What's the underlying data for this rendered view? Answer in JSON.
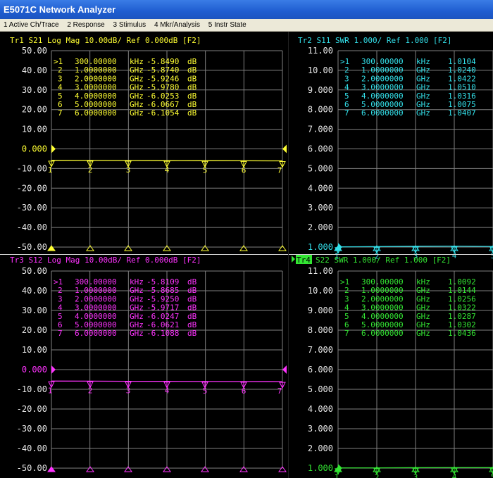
{
  "window": {
    "title": "E5071C Network Analyzer"
  },
  "menu": [
    {
      "id": "active-ch-trace",
      "label": "1 Active Ch/Trace"
    },
    {
      "id": "response",
      "label": "2 Response"
    },
    {
      "id": "stimulus",
      "label": "3 Stimulus"
    },
    {
      "id": "mkr-analysis",
      "label": "4 Mkr/Analysis"
    },
    {
      "id": "instr-state",
      "label": "5 Instr State"
    }
  ],
  "colors": {
    "background": "#000000",
    "grid": "#808080",
    "tr1": "#ffff33",
    "tr2": "#33e0ea",
    "tr3": "#ff33ff",
    "tr4": "#33e633",
    "menubar": "#ece9d8",
    "titlebar": "#2060d8"
  },
  "traces": [
    {
      "id": "tr1",
      "header": "Tr1  S21  Log Mag 10.00dB/  Ref 0.000dB  [F2]",
      "ticks": [
        "50.00",
        "40.00",
        "30.00",
        "20.00",
        "10.00",
        "0.000",
        "-10.00",
        "-20.00",
        "-30.00",
        "-40.00",
        "-50.00"
      ],
      "ylim": [
        -50,
        50
      ],
      "ref_value": 0,
      "ref_label": "0.000",
      "active": false,
      "icon_left": "ref-level-arrow-icon",
      "markers": [
        {
          "num": "1",
          "sel": ">1",
          "freq": "300.00000",
          "unit": "kHz",
          "val": "-5.8490",
          "vunit": "dB"
        },
        {
          "num": "2",
          "sel": "2",
          "freq": "1.0000000",
          "unit": "GHz",
          "val": "-5.8740",
          "vunit": "dB"
        },
        {
          "num": "3",
          "sel": "3",
          "freq": "2.0000000",
          "unit": "GHz",
          "val": "-5.9246",
          "vunit": "dB"
        },
        {
          "num": "4",
          "sel": "4",
          "freq": "3.0000000",
          "unit": "GHz",
          "val": "-5.9780",
          "vunit": "dB"
        },
        {
          "num": "5",
          "sel": "5",
          "freq": "4.0000000",
          "unit": "GHz",
          "val": "-6.0253",
          "vunit": "dB"
        },
        {
          "num": "6",
          "sel": "6",
          "freq": "5.0000000",
          "unit": "GHz",
          "val": "-6.0667",
          "vunit": "dB"
        },
        {
          "num": "7",
          "sel": "7",
          "freq": "6.0000000",
          "unit": "GHz",
          "val": "-6.1054",
          "vunit": "dB"
        }
      ]
    },
    {
      "id": "tr2",
      "header": "Tr2  S11  SWR 1.000/  Ref 1.000  [F2]",
      "ticks": [
        "11.00",
        "10.00",
        "9.000",
        "8.000",
        "7.000",
        "6.000",
        "5.000",
        "4.000",
        "3.000",
        "2.000",
        "1.000"
      ],
      "ylim": [
        1,
        11
      ],
      "ref_value": 1,
      "ref_label": "1.000",
      "active": false,
      "markers": [
        {
          "num": "1",
          "sel": ">1",
          "freq": "300.00000",
          "unit": "kHz",
          "val": "1.0104",
          "vunit": ""
        },
        {
          "num": "2",
          "sel": "2",
          "freq": "1.0000000",
          "unit": "GHz",
          "val": "1.0240",
          "vunit": ""
        },
        {
          "num": "3",
          "sel": "3",
          "freq": "2.0000000",
          "unit": "GHz",
          "val": "1.0422",
          "vunit": ""
        },
        {
          "num": "4",
          "sel": "4",
          "freq": "3.0000000",
          "unit": "GHz",
          "val": "1.0510",
          "vunit": ""
        },
        {
          "num": "5",
          "sel": "5",
          "freq": "4.0000000",
          "unit": "GHz",
          "val": "1.0316",
          "vunit": ""
        },
        {
          "num": "6",
          "sel": "6",
          "freq": "5.0000000",
          "unit": "GHz",
          "val": "1.0075",
          "vunit": ""
        },
        {
          "num": "7",
          "sel": "7",
          "freq": "6.0000000",
          "unit": "GHz",
          "val": "1.0407",
          "vunit": ""
        }
      ]
    },
    {
      "id": "tr3",
      "header": "Tr3  S12  Log Mag 10.00dB/  Ref 0.000dB  [F2]",
      "ticks": [
        "50.00",
        "40.00",
        "30.00",
        "20.00",
        "10.00",
        "0.000",
        "-10.00",
        "-20.00",
        "-30.00",
        "-40.00",
        "-50.00"
      ],
      "ylim": [
        -50,
        50
      ],
      "ref_value": 0,
      "ref_label": "0.000",
      "active": false,
      "markers": [
        {
          "num": "1",
          "sel": ">1",
          "freq": "300.00000",
          "unit": "kHz",
          "val": "-5.8109",
          "vunit": "dB"
        },
        {
          "num": "2",
          "sel": "2",
          "freq": "1.0000000",
          "unit": "GHz",
          "val": "-5.8685",
          "vunit": "dB"
        },
        {
          "num": "3",
          "sel": "3",
          "freq": "2.0000000",
          "unit": "GHz",
          "val": "-5.9250",
          "vunit": "dB"
        },
        {
          "num": "4",
          "sel": "4",
          "freq": "3.0000000",
          "unit": "GHz",
          "val": "-5.9717",
          "vunit": "dB"
        },
        {
          "num": "5",
          "sel": "5",
          "freq": "4.0000000",
          "unit": "GHz",
          "val": "-6.0247",
          "vunit": "dB"
        },
        {
          "num": "6",
          "sel": "6",
          "freq": "5.0000000",
          "unit": "GHz",
          "val": "-6.0621",
          "vunit": "dB"
        },
        {
          "num": "7",
          "sel": "7",
          "freq": "6.0000000",
          "unit": "GHz",
          "val": "-6.1088",
          "vunit": "dB"
        }
      ]
    },
    {
      "id": "tr4",
      "header_label": "Tr4",
      "header": "S22  SWR 1.000/  Ref 1.000  [F2]",
      "ticks": [
        "11.00",
        "10.00",
        "9.000",
        "8.000",
        "7.000",
        "6.000",
        "5.000",
        "4.000",
        "3.000",
        "2.000",
        "1.000"
      ],
      "ylim": [
        1,
        11
      ],
      "ref_value": 1,
      "ref_label": "1.000",
      "active": true,
      "markers": [
        {
          "num": "1",
          "sel": ">1",
          "freq": "300.00000",
          "unit": "kHz",
          "val": "1.0092",
          "vunit": ""
        },
        {
          "num": "2",
          "sel": "2",
          "freq": "1.0000000",
          "unit": "GHz",
          "val": "1.0144",
          "vunit": ""
        },
        {
          "num": "3",
          "sel": "3",
          "freq": "2.0000000",
          "unit": "GHz",
          "val": "1.0256",
          "vunit": ""
        },
        {
          "num": "4",
          "sel": "4",
          "freq": "3.0000000",
          "unit": "GHz",
          "val": "1.0322",
          "vunit": ""
        },
        {
          "num": "5",
          "sel": "5",
          "freq": "4.0000000",
          "unit": "GHz",
          "val": "1.0287",
          "vunit": ""
        },
        {
          "num": "6",
          "sel": "6",
          "freq": "5.0000000",
          "unit": "GHz",
          "val": "1.0302",
          "vunit": ""
        },
        {
          "num": "7",
          "sel": "7",
          "freq": "6.0000000",
          "unit": "GHz",
          "val": "1.0436",
          "vunit": ""
        }
      ]
    }
  ]
}
